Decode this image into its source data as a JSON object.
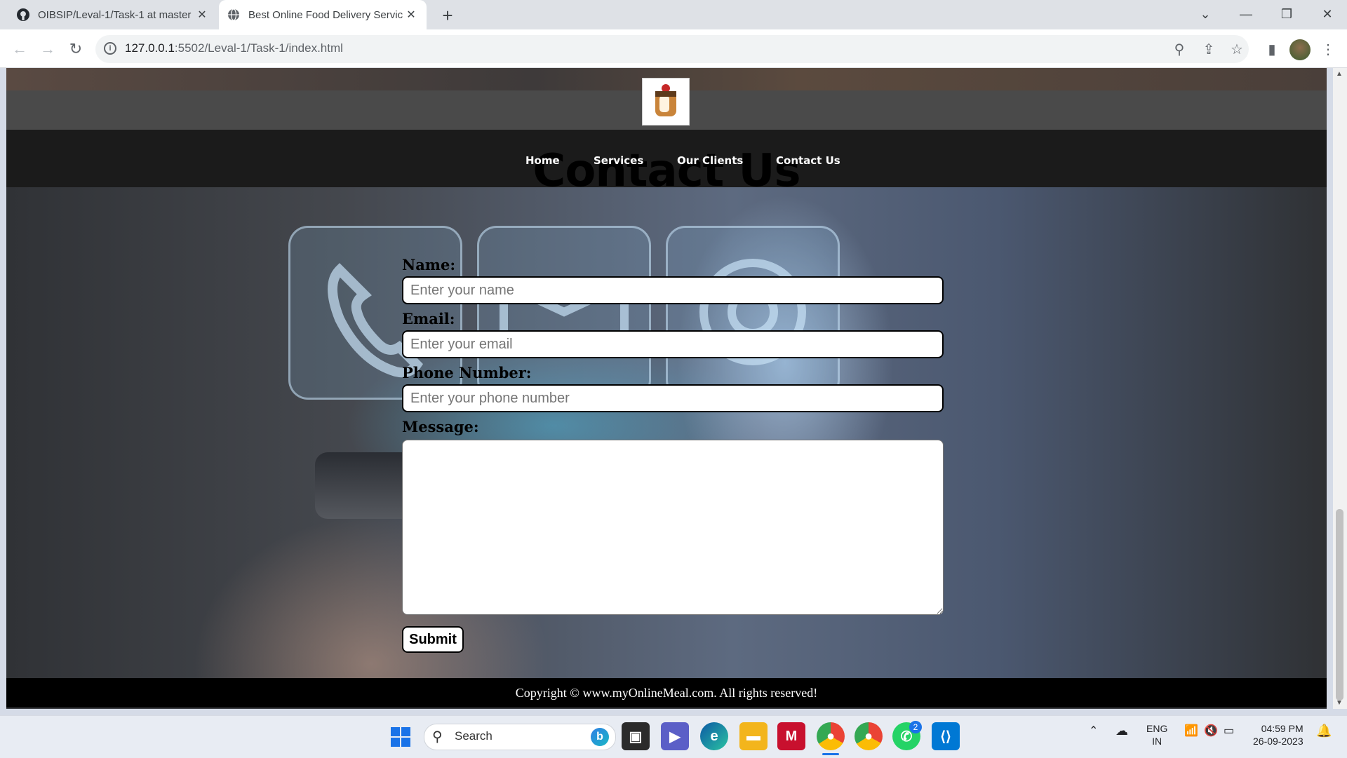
{
  "browser": {
    "tabs": [
      {
        "title": "OIBSIP/Leval-1/Task-1 at master",
        "icon": "github-icon"
      },
      {
        "title": "Best Online Food Delivery Servic",
        "icon": "globe-icon"
      }
    ],
    "url_host": "127.0.0.1",
    "url_rest": ":5502/Leval-1/Task-1/index.html"
  },
  "page": {
    "nav": [
      "Home",
      "Services",
      "Our Clients",
      "Contact Us"
    ],
    "section_title": "Contact Us",
    "form": {
      "name_label": "Name:",
      "name_placeholder": "Enter your name",
      "email_label": "Email:",
      "email_placeholder": "Enter your email",
      "phone_label": "Phone Number:",
      "phone_placeholder": "Enter your phone number",
      "message_label": "Message:",
      "submit_label": "Submit"
    },
    "footer": "Copyright © www.myOnlineMeal.com. All rights reserved!"
  },
  "taskbar": {
    "search": "Search",
    "lang_1": "ENG",
    "lang_2": "IN",
    "time": "04:59 PM",
    "date": "26-09-2023",
    "whatsapp_badge": "2"
  },
  "colors": {
    "navbar": "#1b1b1b",
    "footer": "#000000",
    "logobar": "#4a4a4a"
  }
}
